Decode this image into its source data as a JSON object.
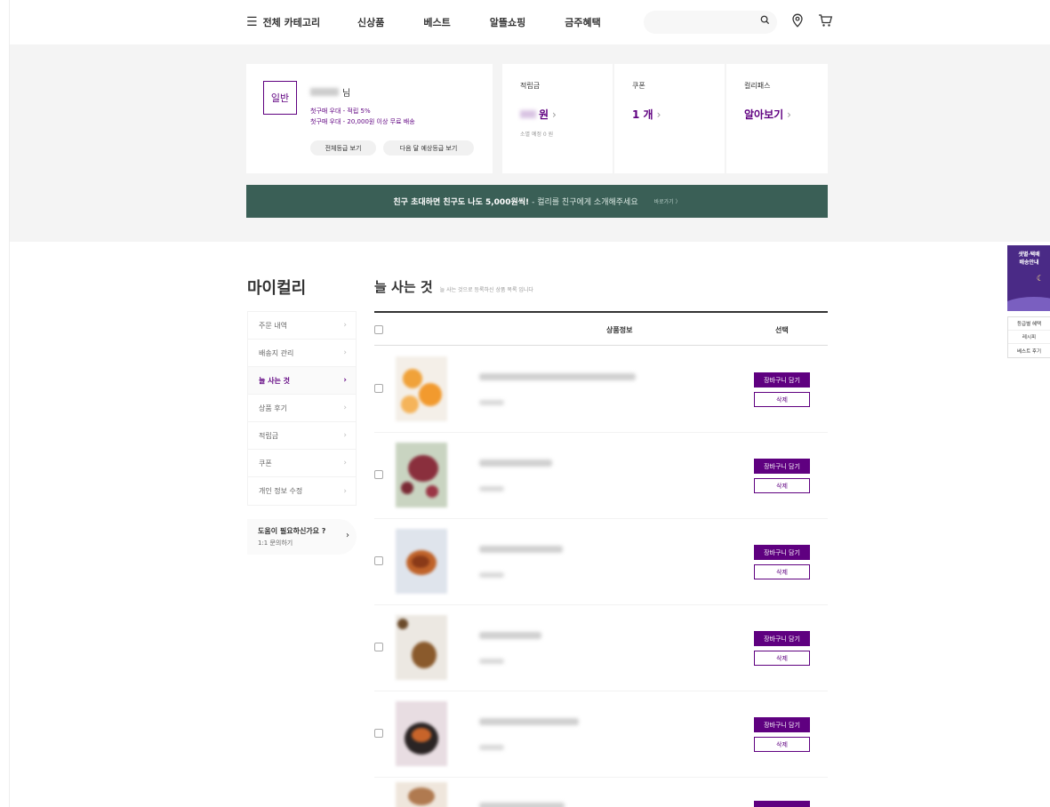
{
  "header": {
    "category_label": "전체 카테고리",
    "menu": [
      "신상품",
      "베스트",
      "알뜰쇼핑",
      "금주혜택"
    ],
    "search_placeholder": "",
    "icons": [
      "search-icon",
      "location-pin-icon",
      "cart-icon"
    ]
  },
  "profile": {
    "grade": "일반",
    "name_suffix": "님",
    "benefit_1": "첫구매 우대 - 적립 5%",
    "benefit_2": "첫구매 우대 - 20,000원 이상 무료 배송",
    "all_grades_label": "전체등급 보기",
    "next_grade_label": "다음 달 예상등급 보기"
  },
  "points": {
    "label": "적립금",
    "unit": "원",
    "sub": "소멸 예정 0 원"
  },
  "coupon": {
    "label": "쿠폰",
    "value": "1 개"
  },
  "kurlypass": {
    "label": "컬리패스",
    "value": "알아보기"
  },
  "banner": {
    "bold": "친구 초대하면 친구도 나도 5,000원씩!",
    "text": "- 컬리를 친구에게 소개해주세요",
    "link": "바로가기 〉"
  },
  "sidebar": {
    "title": "마이컬리",
    "items": [
      {
        "label": "주문 내역",
        "active": false
      },
      {
        "label": "배송지 관리",
        "active": false
      },
      {
        "label": "늘 사는 것",
        "active": true
      },
      {
        "label": "상품 후기",
        "active": false
      },
      {
        "label": "적립금",
        "active": false
      },
      {
        "label": "쿠폰",
        "active": false
      },
      {
        "label": "개인 정보 수정",
        "active": false
      }
    ],
    "help_title": "도움이 필요하신가요 ?",
    "help_sub": "1:1 문의하기"
  },
  "main": {
    "title": "늘 사는 것",
    "subtitle": "늘 사는 것으로 등록하신 상품 목록 입니다",
    "col_info": "상품정보",
    "col_select": "선택",
    "cart_label": "장바구니 담기",
    "delete_label": "삭제",
    "rows": 5
  },
  "float": {
    "ad_line1": "샛별·택배",
    "ad_line2": "배송안내",
    "menu": [
      "등급별 혜택",
      "레시피",
      "베스트 후기"
    ]
  },
  "colors": {
    "brand": "#5f0080",
    "banner": "#3a5f56"
  }
}
